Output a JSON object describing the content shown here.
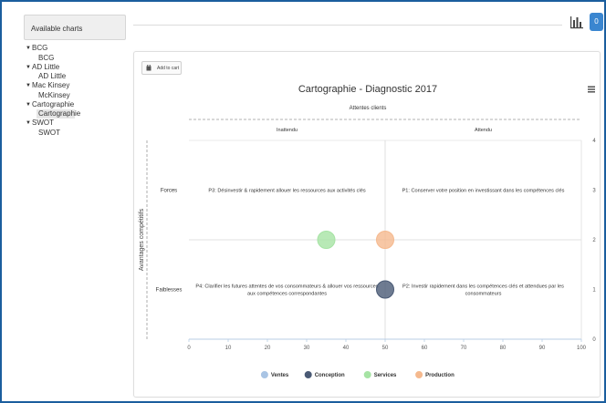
{
  "sidebar": {
    "header": "Available charts",
    "groups": [
      {
        "label": "BCG",
        "child": "BCG"
      },
      {
        "label": "AD Little",
        "child": "AD Little"
      },
      {
        "label": "Mac Kinsey",
        "child": "McKinsey"
      },
      {
        "label": "Cartographie",
        "child": "Cartographie"
      },
      {
        "label": "SWOT",
        "child": "SWOT"
      }
    ],
    "selected": "Cartographie"
  },
  "toolbar": {
    "chart_icon": "bar-chart-icon",
    "badge_count": "0"
  },
  "panel": {
    "add_to_cart_label": "Add to cart",
    "cart_icon": "cart-icon",
    "menu_icon": "hamburger-menu-icon"
  },
  "chart_data": {
    "type": "scatter",
    "title": "Cartographie - Diagnostic 2017",
    "subtitle": "Attentes clients",
    "top_labels": [
      "Inattendu",
      "Attendu"
    ],
    "row_labels": [
      "Forces",
      "Faiblesses"
    ],
    "ylabel": "Avantages compétitifs",
    "xlim": [
      0,
      100
    ],
    "ylim": [
      0,
      4
    ],
    "x_ticks": [
      0,
      10,
      20,
      30,
      40,
      50,
      60,
      70,
      80,
      90,
      100
    ],
    "y_ticks": [
      0,
      1,
      2,
      3,
      4
    ],
    "quadrant_texts": [
      "P3: Désinvestir & rapidement allouer les ressources aux activités clés",
      "P1: Conserver votre position en investissant dans les compétences clés",
      "P4: Clarifier les futures attentes de vos consommateurs & allouer vos ressources aux compétences correspondantes",
      "P2: Investir rapidement dans les compétences clés et attendues par les consommateurs"
    ],
    "series": [
      {
        "name": "Ventes",
        "color": "#a9c4e4",
        "points": []
      },
      {
        "name": "Conception",
        "color": "#4a5a75",
        "points": [
          {
            "x": 50,
            "y": 1
          }
        ]
      },
      {
        "name": "Services",
        "color": "#a6e3a4",
        "points": [
          {
            "x": 35,
            "y": 2
          }
        ]
      },
      {
        "name": "Production",
        "color": "#f5b98e",
        "points": [
          {
            "x": 50,
            "y": 2
          }
        ]
      }
    ],
    "grid": true,
    "legend_position": "bottom"
  }
}
